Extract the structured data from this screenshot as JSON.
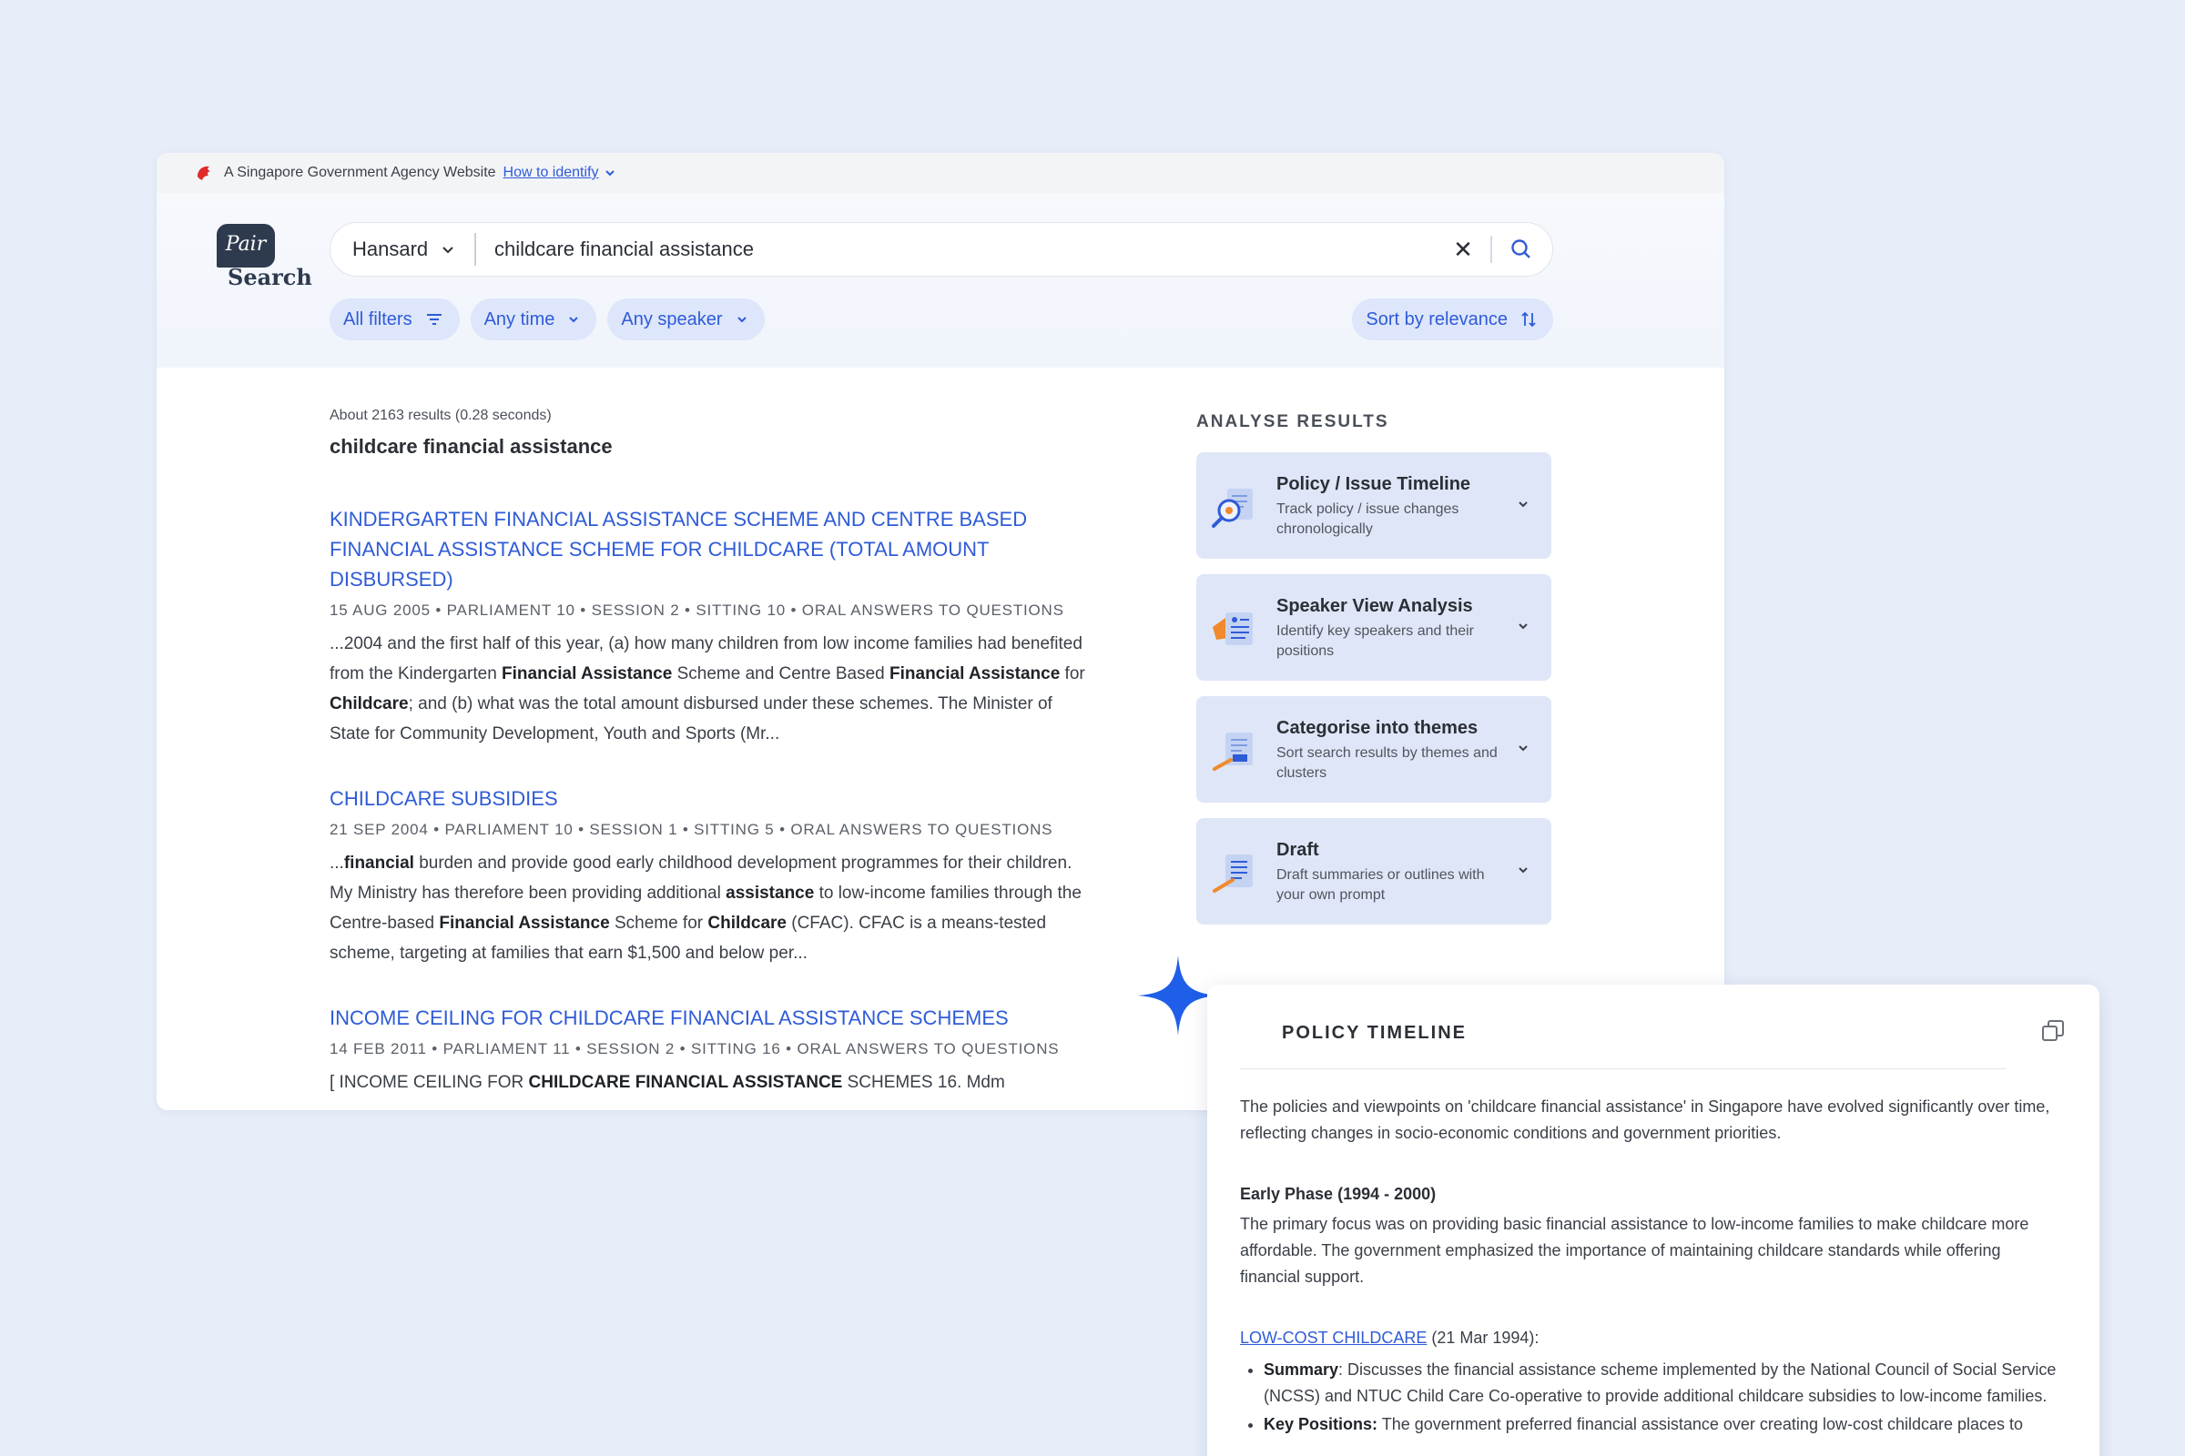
{
  "masthead": {
    "text": "A Singapore Government Agency Website",
    "link": "How to identify"
  },
  "logo": {
    "bubble": "Pair",
    "word": "Search"
  },
  "search": {
    "scope": "Hansard",
    "query": "childcare financial assistance",
    "clear": "✕"
  },
  "filters": {
    "all": "All filters",
    "time": "Any time",
    "speaker": "Any speaker",
    "sort": "Sort by relevance"
  },
  "results": {
    "count": "About 2163 results (0.28 seconds)",
    "query_title": "childcare financial assistance",
    "items": [
      {
        "title": "KINDERGARTEN FINANCIAL ASSISTANCE SCHEME AND CENTRE BASED FINANCIAL ASSISTANCE SCHEME FOR CHILDCARE (TOTAL AMOUNT DISBURSED)",
        "meta": "15 AUG 2005 • PARLIAMENT 10 • SESSION 2 • SITTING 10 • ORAL ANSWERS TO QUESTIONS",
        "snippet_parts": [
          "...2004 and the first half of this year, (a) how many children from low income families had benefited from the Kindergarten ",
          "Financial Assistance",
          " Scheme and Centre Based ",
          "Financial Assistance",
          " for ",
          "Childcare",
          "; and (b) what was the total amount disbursed under these schemes. The Minister of State for Community Development, Youth and Sports (Mr..."
        ]
      },
      {
        "title": "CHILDCARE SUBSIDIES",
        "meta": "21 SEP 2004 • PARLIAMENT 10 • SESSION 1 • SITTING 5 • ORAL ANSWERS TO QUESTIONS",
        "snippet_parts": [
          "...",
          "financial",
          " burden and provide good early childhood development programmes for their children. My Ministry has therefore been providing additional ",
          "assistance",
          " to low-income families through the Centre-based ",
          "Financial Assistance",
          " Scheme for ",
          "Childcare",
          " (CFAC). CFAC is a means-tested scheme, targeting at families that earn $1,500 and below per..."
        ]
      },
      {
        "title": "INCOME CEILING FOR CHILDCARE FINANCIAL ASSISTANCE SCHEMES",
        "meta": "14 FEB 2011 • PARLIAMENT 11 • SESSION 2 • SITTING 16 • ORAL ANSWERS TO QUESTIONS",
        "snippet_parts": [
          "[ INCOME CEILING FOR ",
          "CHILDCARE FINANCIAL ASSISTANCE",
          " SCHEMES 16. Mdm"
        ]
      }
    ]
  },
  "analyse": {
    "heading": "ANALYSE RESULTS",
    "cards": [
      {
        "title": "Policy / Issue Timeline",
        "desc": "Track policy / issue changes chronologically",
        "icon": "timeline-magnifier-icon"
      },
      {
        "title": "Speaker View Analysis",
        "desc": "Identify key speakers and their positions",
        "icon": "speaker-document-icon"
      },
      {
        "title": "Categorise into themes",
        "desc": "Sort search results by themes and clusters",
        "icon": "categorise-document-icon"
      },
      {
        "title": "Draft",
        "desc": "Draft summaries or outlines with your own prompt",
        "icon": "draft-document-icon"
      }
    ]
  },
  "popup": {
    "title": "POLICY TIMELINE",
    "intro": "The policies and viewpoints on 'childcare financial assistance' in Singapore have evolved significantly over time, reflecting changes in socio-economic conditions and government priorities.",
    "phase_title": "Early Phase (1994 - 2000)",
    "phase_text": "The primary focus was on providing basic financial assistance to low-income families to make childcare more affordable. The government emphasized the importance of maintaining childcare standards while offering financial support.",
    "entry_link": "LOW-COST CHILDCARE",
    "entry_date": " (21 Mar 1994):",
    "bullets": [
      {
        "label": "Summary",
        "text": ": Discusses the financial assistance scheme implemented by the National Council of Social Service (NCSS) and NTUC Child Care Co-operative to provide additional childcare subsidies to low-income families."
      },
      {
        "label": "Key Positions:",
        "text": " The government preferred financial assistance over creating low-cost childcare places to"
      }
    ]
  },
  "colors": {
    "accent": "#2f5bd7",
    "background": "#e8eef9",
    "chip": "#dde6fa",
    "analyse_card": "#dfe6f7"
  }
}
